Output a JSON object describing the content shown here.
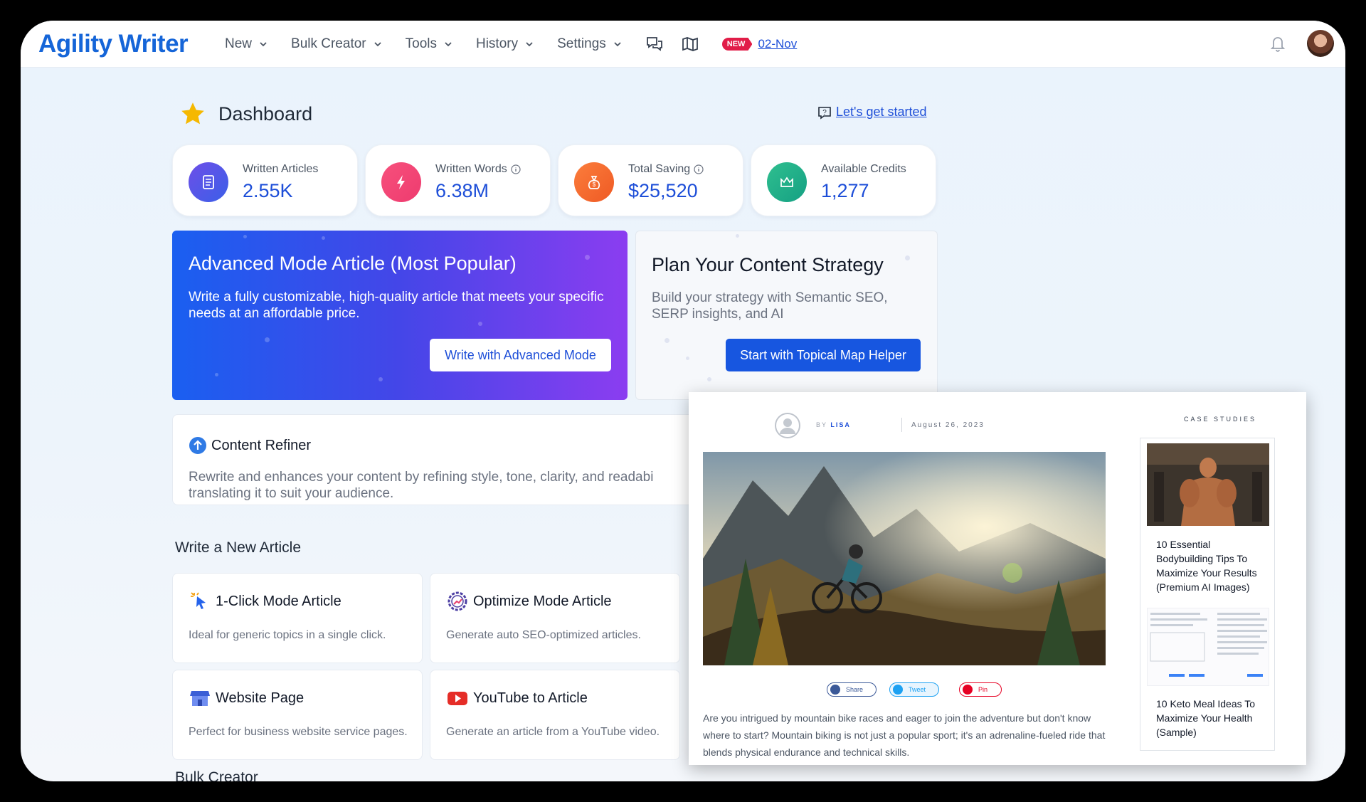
{
  "brand": {
    "name": "Agility Writer"
  },
  "nav": {
    "items": [
      {
        "label": "New"
      },
      {
        "label": "Bulk Creator"
      },
      {
        "label": "Tools"
      },
      {
        "label": "History"
      },
      {
        "label": "Settings"
      }
    ],
    "new_badge": "NEW",
    "new_link": "02-Nov"
  },
  "dashboard": {
    "title": "Dashboard",
    "get_started": "Let's get started"
  },
  "stats": [
    {
      "label": "Written Articles",
      "value": "2.55K",
      "icon": "document-icon",
      "color": "#5b4fe0"
    },
    {
      "label": "Written Words",
      "value": "6.38M",
      "icon": "lightning-icon",
      "color": "#f0457a"
    },
    {
      "label": "Total Saving",
      "value": "$25,520",
      "icon": "money-bag-icon",
      "color": "#f56a2c"
    },
    {
      "label": "Available Credits",
      "value": "1,277",
      "icon": "crown-icon",
      "color": "#1fa98a"
    }
  ],
  "promo_advanced": {
    "title": "Advanced Mode Article (Most Popular)",
    "text": "Write a fully customizable, high-quality article that meets your specific needs at an affordable price.",
    "button": "Write with Advanced Mode"
  },
  "promo_strategy": {
    "title": "Plan Your Content Strategy",
    "text": "Build your strategy with Semantic SEO, SERP insights, and AI",
    "button": "Start with Topical Map Helper"
  },
  "refiner": {
    "title": "Content Refiner",
    "text": "Rewrite and enhances your content by refining style, tone, clarity, and readabi",
    "text2": "translating it to suit your audience."
  },
  "write_new": {
    "heading": "Write a New Article",
    "cards": [
      {
        "title": "1-Click Mode Article",
        "desc": "Ideal for generic topics in a single click."
      },
      {
        "title": "Optimize Mode Article",
        "desc": "Generate auto SEO-optimized articles."
      },
      {
        "title": "Website Page",
        "desc": "Perfect for business website service pages."
      },
      {
        "title": "YouTube to Article",
        "desc": "Generate an article from a YouTube video."
      }
    ]
  },
  "bulk_heading": "Bulk Creator",
  "preview": {
    "by": "BY",
    "author": "LISA",
    "date": "August 26, 2023",
    "case_studies": "CASE STUDIES",
    "share": "Share",
    "tweet": "Tweet",
    "pin": "Pin",
    "body": "Are you intrigued by mountain bike races and eager to join the adventure but don't know where to start? Mountain biking is not just a popular sport; it's an adrenaline-fueled ride that blends physical endurance and technical skills.",
    "side_items": [
      {
        "title": "10 Essential Bodybuilding Tips To Maximize Your Results (Premium AI Images)"
      },
      {
        "title": "10 Keto Meal Ideas To Maximize Your Health (Sample)"
      }
    ]
  }
}
